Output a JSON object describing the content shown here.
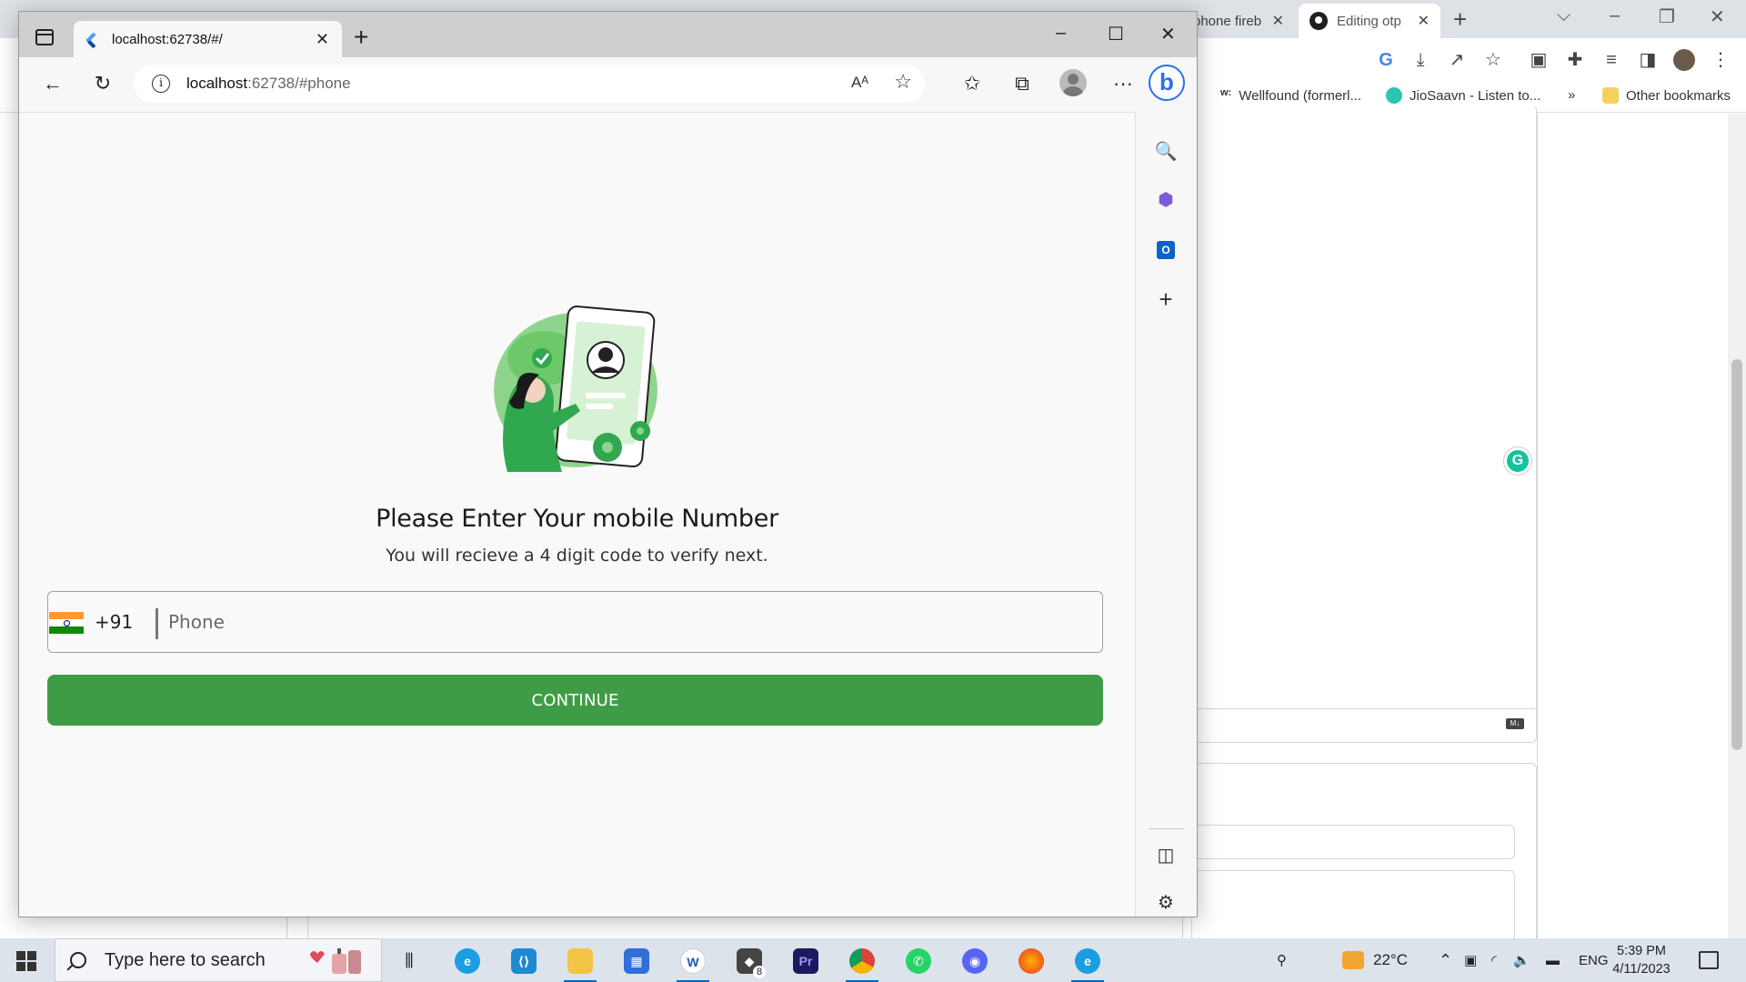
{
  "chrome": {
    "tabs": [
      {
        "label": "phone fireb"
      },
      {
        "label": "Editing otp"
      }
    ],
    "bookmarks": [
      {
        "label": "Wellfound (formerl...",
        "icon": "wellfound-icon"
      },
      {
        "label": "JioSaavn - Listen to...",
        "icon": "jiosaavn-icon"
      }
    ],
    "bookmarks_more": "»",
    "other_bookmarks": "Other bookmarks"
  },
  "edge": {
    "tab_title": "localhost:62738/#/",
    "address_host": "localhost",
    "address_path": ":62738/#phone",
    "read_aloud": "A",
    "bing_label": "b"
  },
  "page": {
    "heading": "Please Enter Your mobile Number",
    "subheading": "You will recieve a 4 digit code to verify next.",
    "dial_code": "+91",
    "phone_placeholder": "Phone",
    "phone_value": "",
    "continue_label": "CONTINUE",
    "accent_color": "#3f9c46"
  },
  "taskbar": {
    "search_placeholder": "Type here to search",
    "weather": "22°C",
    "language": "ENG",
    "time": "5:39 PM",
    "date": "4/11/2023",
    "badge_count": "8"
  }
}
